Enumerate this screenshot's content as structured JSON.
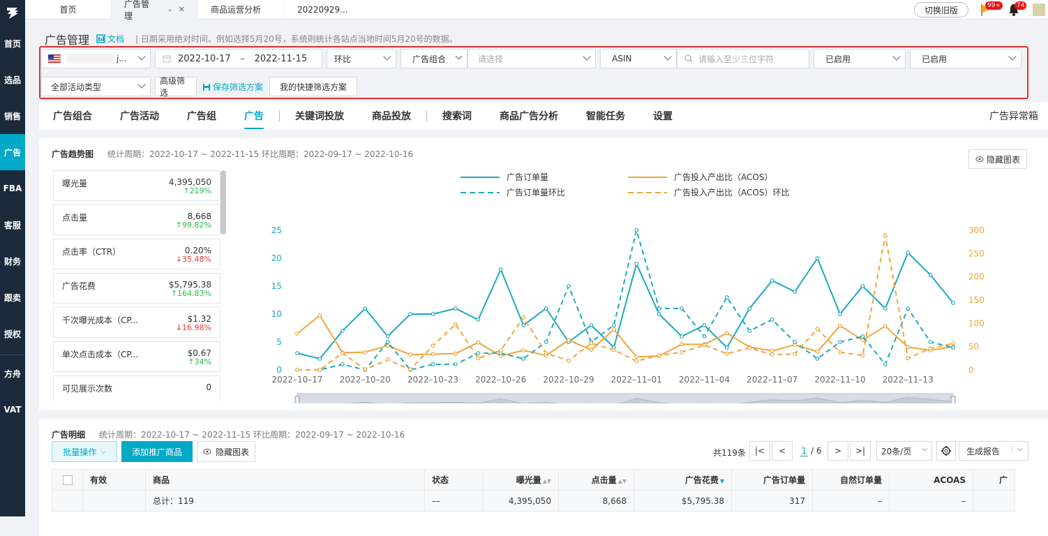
{
  "sidebar": {
    "items": [
      {
        "label": "首页"
      },
      {
        "label": "选品"
      },
      {
        "label": "销售"
      },
      {
        "label": "广告",
        "active": true
      },
      {
        "label": "FBA"
      },
      {
        "label": "客服"
      },
      {
        "label": "财务"
      },
      {
        "label": "跟卖"
      },
      {
        "label": "授权"
      },
      {
        "label": "方舟"
      },
      {
        "label": "VAT"
      }
    ]
  },
  "topbar": {
    "tabs": [
      {
        "label": "首页"
      },
      {
        "label": "广告管理",
        "active": true
      },
      {
        "label": "商品运营分析"
      },
      {
        "label": "20220929..."
      }
    ],
    "switch_label": "切换旧版",
    "flag_badge": "99+",
    "bell_badge": "74"
  },
  "header": {
    "title": "广告管理",
    "doc_label": "文档",
    "note": "日期采用绝对时间。例如选择5月20号，系统则统计各站点当地时间5月20号的数据。"
  },
  "filters": {
    "site_value": "j...",
    "date_start": "2022-10-17",
    "date_sep": "–",
    "date_end": "2022-11-15",
    "compare": "环比",
    "group_label": "广告组合",
    "group_placeholder": "请选择",
    "asin_label": "ASIN",
    "search_placeholder": "请输入至少三位字符",
    "status1": "已启用",
    "status2": "已启用",
    "activity_type": "全部活动类型",
    "advanced": "高级筛选",
    "save_plan": "保存筛选方案",
    "my_plans": "我的快捷筛选方案"
  },
  "main_tabs": [
    "广告组合",
    "广告活动",
    "广告组",
    "广告",
    "关键词投放",
    "商品投放",
    "搜索词",
    "商品广告分析",
    "智能任务",
    "设置"
  ],
  "active_tab": "广告",
  "anomaly_box": "广告异常箱",
  "trend": {
    "title": "广告趋势图",
    "period": "统计周期：2022-10-17 ~ 2022-11-15 环比周期：2022-09-17 ~ 2022-10-16",
    "hide_chart": "隐藏图表",
    "metrics": [
      {
        "name": "曝光量",
        "value": "4,395,050",
        "change": "219%",
        "dir": "up"
      },
      {
        "name": "点击量",
        "value": "8,668",
        "change": "99.82%",
        "dir": "up"
      },
      {
        "name": "点击率（CTR）",
        "value": "0.20%",
        "change": "35.48%",
        "dir": "down"
      },
      {
        "name": "广告花费",
        "value": "$5,795.38",
        "change": "164.83%",
        "dir": "up"
      },
      {
        "name": "千次曝光成本（CP...",
        "value": "$1.32",
        "change": "16.98%",
        "dir": "down"
      },
      {
        "name": "单次点击成本（CP...",
        "value": "$0.67",
        "change": "34%",
        "dir": "up"
      },
      {
        "name": "可见展示次数",
        "value": "0",
        "change": "",
        "dir": ""
      }
    ]
  },
  "chart_data": {
    "type": "line",
    "x": [
      "2022-10-17",
      "2022-10-18",
      "2022-10-19",
      "2022-10-20",
      "2022-10-21",
      "2022-10-22",
      "2022-10-23",
      "2022-10-24",
      "2022-10-25",
      "2022-10-26",
      "2022-10-27",
      "2022-10-28",
      "2022-10-29",
      "2022-10-30",
      "2022-10-31",
      "2022-11-01",
      "2022-11-02",
      "2022-11-03",
      "2022-11-04",
      "2022-11-05",
      "2022-11-06",
      "2022-11-07",
      "2022-11-08",
      "2022-11-09",
      "2022-11-10",
      "2022-11-11",
      "2022-11-12",
      "2022-11-13",
      "2022-11-14",
      "2022-11-15"
    ],
    "x_ticks": [
      "2022–10–17",
      "2022–10–20",
      "2022–10–23",
      "2022–10–26",
      "2022–10–29",
      "2022–11–01",
      "2022–11–04",
      "2022–11–07",
      "2022–11–10",
      "2022–11–13"
    ],
    "y_left": {
      "min": 0,
      "max": 25,
      "ticks": [
        "0",
        "5",
        "10",
        "15",
        "20",
        "25"
      ]
    },
    "y_right": {
      "min": 0,
      "max": 300,
      "ticks": [
        "0",
        "50",
        "100",
        "150",
        "200",
        "250",
        "300"
      ]
    },
    "grid": false,
    "legend": "top",
    "series": [
      {
        "name": "广告订单量",
        "axis": "left",
        "style": "solid",
        "color": "#1aa9c0",
        "values": [
          3,
          2,
          7,
          11,
          6,
          10,
          10,
          11,
          9,
          18,
          8,
          11,
          5,
          8,
          4,
          19,
          10,
          6,
          8,
          4,
          11,
          16,
          14,
          20,
          10,
          15,
          11,
          21,
          17,
          12
        ]
      },
      {
        "name": "广告投入产出比（ACOS）",
        "axis": "right",
        "style": "solid",
        "color": "#f0a43a",
        "values": [
          78,
          117,
          37,
          38,
          52,
          33,
          34,
          35,
          59,
          30,
          42,
          31,
          64,
          43,
          87,
          28,
          30,
          55,
          55,
          79,
          49,
          41,
          54,
          39,
          95,
          64,
          94,
          49,
          42,
          50
        ]
      },
      {
        "name": "广告订单量环比",
        "axis": "left",
        "style": "dashed",
        "color": "#1aa9c0",
        "values": [
          0,
          0,
          1,
          0,
          5,
          0,
          1,
          1,
          3,
          3,
          2,
          5,
          15,
          5,
          8,
          25,
          11,
          11,
          6,
          13,
          7,
          9,
          5,
          2,
          5,
          6,
          1,
          11,
          5,
          4
        ]
      },
      {
        "name": "广告投入产出比（ACOS）环比",
        "axis": "right",
        "style": "dashed",
        "color": "#f0a43a",
        "values": [
          0,
          0,
          36,
          1,
          22,
          1,
          52,
          98,
          25,
          42,
          113,
          36,
          20,
          57,
          43,
          19,
          31,
          38,
          53,
          35,
          47,
          33,
          34,
          88,
          38,
          31,
          289,
          25,
          46,
          57
        ]
      }
    ]
  },
  "detail": {
    "title": "广告明细",
    "period": "统计周期：2022-10-17 ~ 2022-11-15 环比周期：2022-09-17 ~ 2022-10-16",
    "batch": "批量操作",
    "add": "添加推广商品",
    "hide_chart": "隐藏图表",
    "total_count": "共119条",
    "page_current": "1",
    "page_total": "/ 6",
    "page_size": "20条/页",
    "report": "生成报告",
    "columns": [
      "有效",
      "商品",
      "状态",
      "曝光量",
      "点击量",
      "广告花费",
      "广告订单量",
      "自然订单量",
      "ACOAS",
      "广"
    ],
    "total_row": {
      "product": "总计：119",
      "status": "––",
      "impressions": "4,395,050",
      "clicks": "8,668",
      "spend": "$5,795.38",
      "orders": "317",
      "natural": "–",
      "acoas": "–"
    }
  }
}
